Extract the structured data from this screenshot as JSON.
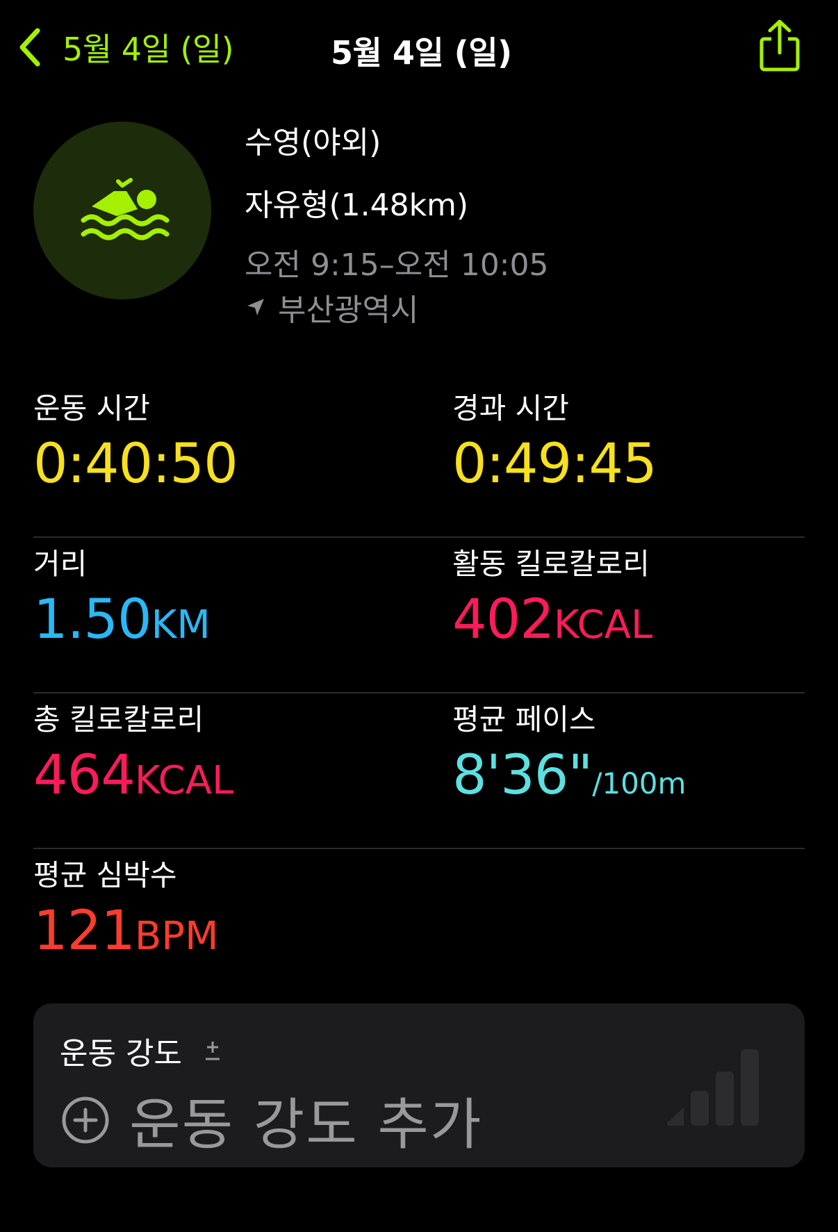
{
  "nav": {
    "back_label": "5월 4일 (일)",
    "title": "5월 4일 (일)"
  },
  "workout": {
    "activity": "수영(야외)",
    "stroke": "자유형(1.48km)",
    "time_range": "오전 9:15–오전 10:05",
    "location": "부산광역시",
    "icon": "swimmer-icon"
  },
  "metrics": {
    "workout_time": {
      "label": "운동 시간",
      "value": "0:40:50"
    },
    "elapsed_time": {
      "label": "경과 시간",
      "value": "0:49:45"
    },
    "distance": {
      "label": "거리",
      "value": "1.50",
      "unit": "KM"
    },
    "active_kcal": {
      "label": "활동 킬로칼로리",
      "value": "402",
      "unit": "KCAL"
    },
    "total_kcal": {
      "label": "총 킬로칼로리",
      "value": "464",
      "unit": "KCAL"
    },
    "avg_pace": {
      "label": "평균 페이스",
      "value": "8'36\"",
      "unit": "/100m"
    },
    "avg_heart_rate": {
      "label": "평균 심박수",
      "value": "121",
      "unit": "BPM"
    }
  },
  "intensity": {
    "title": "운동 강도",
    "add_label": "운동 강도 추가"
  },
  "colors": {
    "accent_green": "#a4f000",
    "time_yellow": "#f7e01e",
    "distance_blue": "#2ab8f6",
    "kcal_pink": "#fa1c59",
    "pace_cyan": "#5ce0e2",
    "heart_red": "#fc3c2d"
  }
}
